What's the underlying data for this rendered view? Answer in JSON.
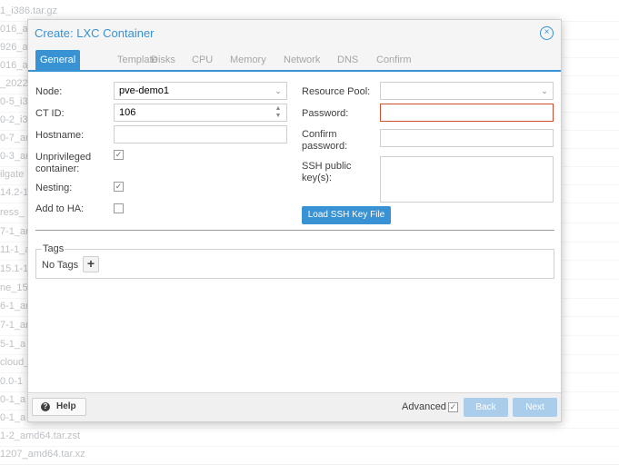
{
  "background_list": [
    "1_i386.tar.gz",
    "016_a",
    "926_a",
    "016_a",
    "_2022",
    "0-5_i3",
    "0-2_i3",
    "0-7_ar",
    "0-3_ar",
    "ilgate",
    "14.2-1",
    "ress_",
    "7-1_ar",
    "11-1_a",
    "15.1-1",
    "ne_15",
    "6-1_ar",
    "7-1_ar",
    "5-1_a",
    "cloud_",
    "0.0-1",
    "0-1_a",
    "0-1_a",
    "1-2_amd64.tar.zst",
    "1207_amd64.tar.xz"
  ],
  "dialog": {
    "title": "Create: LXC Container",
    "close_glyph": "×"
  },
  "tabs": [
    "General",
    "Template",
    "Disks",
    "CPU",
    "Memory",
    "Network",
    "DNS",
    "Confirm"
  ],
  "form": {
    "node": {
      "label": "Node:",
      "value": "pve-demo1"
    },
    "ctid": {
      "label": "CT ID:",
      "value": "106"
    },
    "hostname": {
      "label": "Hostname:",
      "value": ""
    },
    "unprivileged": {
      "label": "Unprivileged container:",
      "checked": true
    },
    "nesting": {
      "label": "Nesting:",
      "checked": true
    },
    "add_to_ha": {
      "label": "Add to HA:",
      "checked": false
    },
    "resource_pool": {
      "label": "Resource Pool:",
      "value": ""
    },
    "password": {
      "label": "Password:",
      "value": ""
    },
    "confirm_password": {
      "label": "Confirm password:",
      "value": ""
    },
    "ssh_keys": {
      "label": "SSH public key(s):",
      "value": ""
    },
    "load_ssh_button": "Load SSH Key File"
  },
  "tags": {
    "legend": "Tags",
    "empty_text": "No Tags",
    "add_glyph": "+"
  },
  "footer": {
    "help_label": "Help",
    "help_glyph": "?",
    "advanced_label": "Advanced",
    "advanced_checked": true,
    "back_label": "Back",
    "next_label": "Next"
  },
  "icons": {
    "check": "✓",
    "combo": "⌄",
    "spin_up": "▲",
    "spin_down": "▼"
  },
  "colors": {
    "accent": "#3892d4",
    "invalid": "#cf4c35",
    "disabled_button": "#a9cdeb"
  }
}
